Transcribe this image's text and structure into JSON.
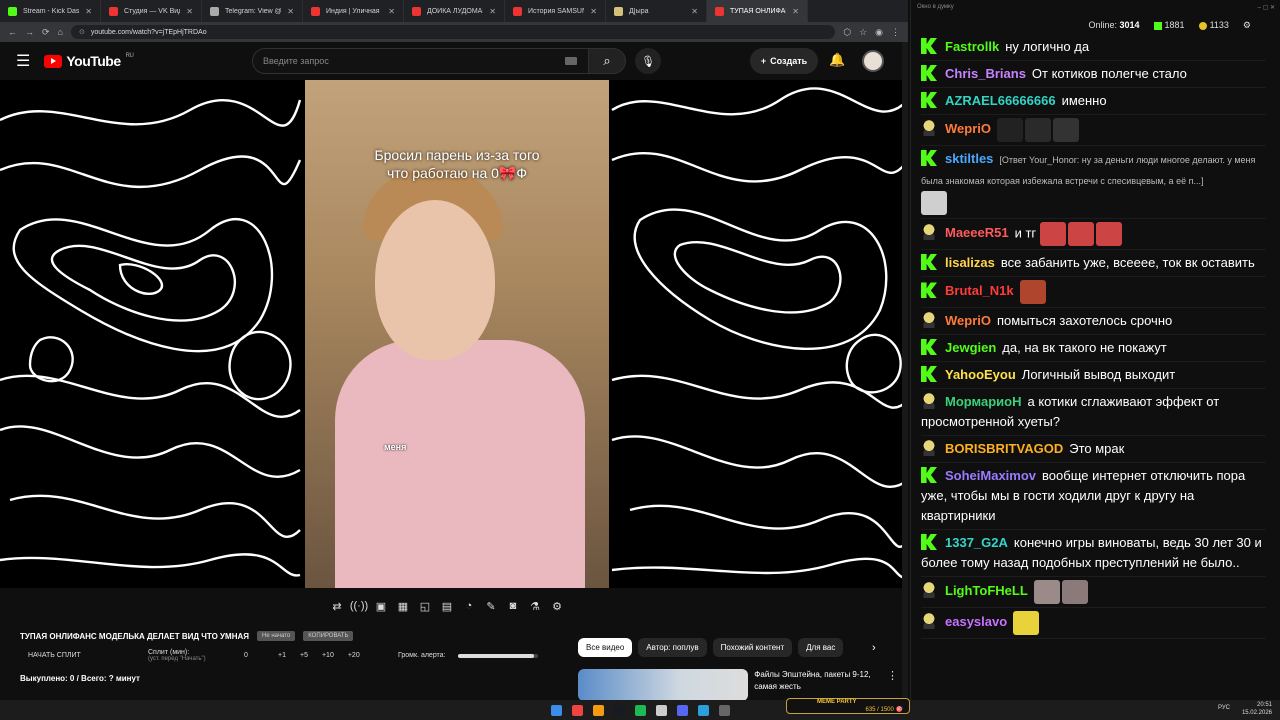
{
  "browser": {
    "tabs": [
      {
        "label": "Stream - Kick Dashboard",
        "color": "#53fc18"
      },
      {
        "label": "Студия — VK Видео Live",
        "color": "#e33"
      },
      {
        "label": "Telegram: View @agmu",
        "color": "#aaa"
      },
      {
        "label": "Индия | Уличная Меда",
        "color": "#e33"
      },
      {
        "label": "ДОЙКА ЛУДОМАНОВ",
        "color": "#e33"
      },
      {
        "label": "История SAMSUNG. Ка",
        "color": "#e33"
      },
      {
        "label": "Д[ыра",
        "color": "#d4c27a"
      },
      {
        "label": "ТУПАЯ ОНЛИФАНС М",
        "color": "#e33",
        "active": true
      }
    ],
    "url": "youtube.com/watch?v=jTEpHjTRDAo",
    "new_tab": "+"
  },
  "youtube": {
    "logo_text": "YouTube",
    "region": "RU",
    "search_placeholder": "Введите запрос",
    "create_label": "Создать",
    "video_caption_line1": "Бросил парень из-за того",
    "video_caption_line2": "что работаю на 0🎀Ф",
    "overlay_label": "меня",
    "video_title": "ТУПАЯ ОНЛИФАНС МОДЕЛЬКА ДЕЛАЕТ ВИД ЧТО УМНАЯ",
    "chip_not_started": "Не начато",
    "chip_copy": "КОПИРОВАТЬ",
    "split_button": "НАЧАТЬ СПЛИТ",
    "split_label": "Сплит (мин):",
    "split_hint": "(уст. перед \"Начать\")",
    "split_value": "0",
    "split_steps": [
      "+1",
      "+5",
      "+10",
      "+20"
    ],
    "alert_label": "Громк. алерта:",
    "alert_volume": 0.95,
    "killed_text": "Выкуплено: 0 / Всего: ? минут",
    "filters": [
      "Все видео",
      "Автор: поплув",
      "Похожий контент",
      "Для вас"
    ],
    "rec_title": "Файлы Эпштейна, пакеты 9-12, самая жесть"
  },
  "chat": {
    "header": "Окно в думку",
    "online_label": "Online:",
    "online_value": "3014",
    "kick_count": "1881",
    "other_count": "1133",
    "messages": [
      {
        "user": "Fastrollk",
        "color": "#53fc18",
        "badge": "k",
        "text": "ну логично да"
      },
      {
        "user": "Chris_Brians",
        "color": "#c882ff",
        "badge": "k",
        "text": "От котиков полегче стало"
      },
      {
        "user": "AZRAEL66666666",
        "color": "#31d4c5",
        "badge": "k",
        "text": "именно"
      },
      {
        "user": "WepriO",
        "color": "#ff7b3a",
        "badge": "h",
        "text": "",
        "emotes": [
          "#222",
          "#2a2a2a",
          "#333"
        ]
      },
      {
        "user": "sktiltles",
        "color": "#4aa8ff",
        "badge": "k",
        "reply": "[Ответ Your_Honor: ну за деньги люди многое делают. у меня была знакомая которая избежала встречи с спесивцевым, а её п...]",
        "emotes": [
          "#cfcfcf"
        ]
      },
      {
        "user": "MaeeeR51",
        "color": "#ff5a5a",
        "badge": "h",
        "text": "и тг",
        "emotes": [
          "#c44",
          "#c44",
          "#c44"
        ]
      },
      {
        "user": "lisalizas",
        "color": "#ffd54a",
        "badge": "k",
        "text": "все забанить уже, всееее, ток вк оставить"
      },
      {
        "user": "Brutal_N1k",
        "color": "#ff3b3b",
        "badge": "k",
        "text": "",
        "emotes": [
          "#b0452e"
        ]
      },
      {
        "user": "WepriO",
        "color": "#ff7b3a",
        "badge": "h",
        "text": "помыться захотелось срочно"
      },
      {
        "user": "Jewgien",
        "color": "#53fc18",
        "badge": "k",
        "text": "да, на вк такого не покажут"
      },
      {
        "user": "YahooEyou",
        "color": "#ffe14a",
        "badge": "k",
        "text": "Логичный вывод выходит"
      },
      {
        "user": "МормариоН",
        "color": "#3ad17a",
        "badge": "h",
        "text": "а котики сглаживают эффект от просмотренной хуеты?"
      },
      {
        "user": "BORISBRITVAGOD",
        "color": "#ffb020",
        "badge": "h",
        "text": "Это мрак"
      },
      {
        "user": "SoheiMaximov",
        "color": "#9b7bff",
        "badge": "k",
        "text": "вообще интернет отключить пора уже, чтобы мы в гости ходили друг к другу на квартирники"
      },
      {
        "user": "1337_G2A",
        "color": "#33d6c8",
        "badge": "k",
        "text": "конечно игры виноваты, ведь 30 лет 30 и более тому назад подобных преступлений не было.."
      },
      {
        "user": "LighToFHeLL",
        "color": "#53fc18",
        "badge": "h",
        "text": "",
        "emotes": [
          "#9a8a8a",
          "#8a7a7a"
        ]
      },
      {
        "user": "easyslavo",
        "color": "#c870ff",
        "badge": "h",
        "text": "",
        "emotes": [
          "#e8d33a"
        ]
      }
    ]
  },
  "taskbar": {
    "meme_party": "MEME PARTY",
    "meme_progress": "635 / 1500 🎯",
    "lang": "РУС",
    "time": "20:51",
    "date": "15.02.2026"
  }
}
